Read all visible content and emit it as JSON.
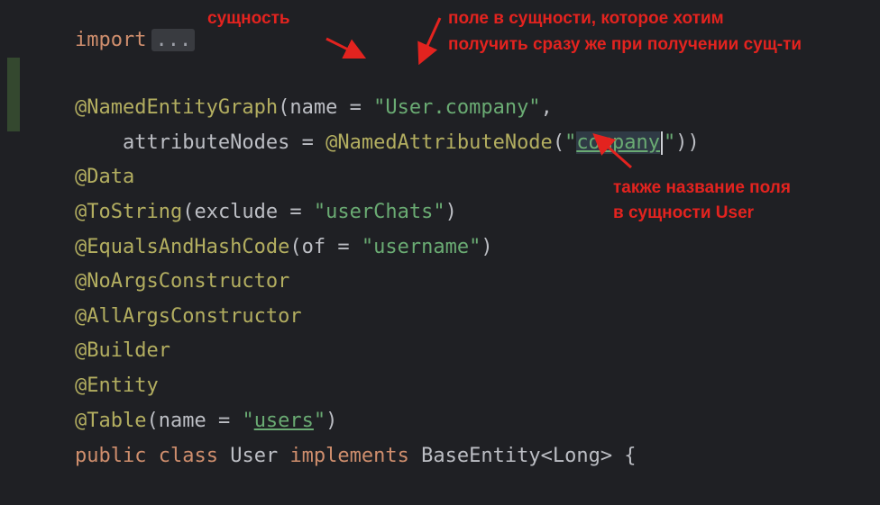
{
  "code": {
    "import_kw": "import",
    "import_collapsed": "...",
    "l1_ann": "@NamedEntityGraph",
    "l1_rest": "(name = ",
    "l1_str": "\"User.company\"",
    "l1_end": ",",
    "l2_indent": "    attributeNodes = ",
    "l2_ann": "@NamedAttributeNode",
    "l2_open": "(",
    "l2_q1": "\"",
    "l2_val": "company",
    "l2_q2": "\"",
    "l2_end": "))",
    "l3_ann": "@Data",
    "l4_ann": "@ToString",
    "l4_rest": "(exclude = ",
    "l4_str": "\"userChats\"",
    "l4_end": ")",
    "l5_ann": "@EqualsAndHashCode",
    "l5_rest": "(of = ",
    "l5_str": "\"username\"",
    "l5_end": ")",
    "l6_ann": "@NoArgsConstructor",
    "l7_ann": "@AllArgsConstructor",
    "l8_ann": "@Builder",
    "l9_ann": "@Entity",
    "l10_ann": "@Table",
    "l10_rest": "(name = ",
    "l10_q1": "\"",
    "l10_val": "users",
    "l10_q2": "\"",
    "l10_end": ")",
    "l11_kw1": "public",
    "l11_kw2": "class",
    "l11_name": "User",
    "l11_kw3": "implements",
    "l11_rest": "BaseEntity<Long> {"
  },
  "annotations": {
    "entity_note": "сущность",
    "field_note_1": "поле в сущности, которое хотим",
    "field_note_2": "получить сразу же при получении сущ-ти",
    "also_note_1": "также название поля",
    "also_note_2": "в сущности User"
  },
  "colors": {
    "arrow": "#e3231f",
    "keyword": "#cf8e6d",
    "annotation": "#b3ae60",
    "string": "#6aab73"
  }
}
